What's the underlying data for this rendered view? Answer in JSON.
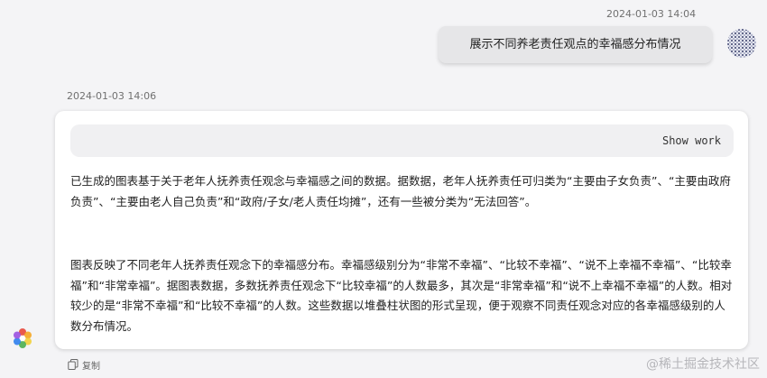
{
  "user_message": {
    "timestamp": "2024-01-03 14:04",
    "text": "展示不同养老责任观点的幸福感分布情况"
  },
  "assistant_message": {
    "timestamp": "2024-01-03 14:06",
    "show_work_label": "Show work",
    "paragraphs": [
      "已生成的图表基于关于老年人抚养责任观念与幸福感之间的数据。据数据，老年人抚养责任可归类为“主要由子女负责”、“主要由政府负责”、“主要由老人自己负责”和“政府/子女/老人责任均摊”，还有一些被分类为“无法回答”。",
      "图表反映了不同老年人抚养责任观念下的幸福感分布。幸福感级别分为“非常不幸福”、“比较不幸福”、“说不上幸福不幸福”、“比较幸福”和“非常幸福”。据图表数据，多数抚养责任观念下“比较幸福”的人数最多，其次是“非常幸福”和“说不上幸福不幸福”的人数。相对较少的是“非常不幸福”和“比较不幸福”的人数。这些数据以堆叠柱状图的形式呈现，便于观察不同责任观念对应的各幸福感级别的人数分布情况。"
    ],
    "copy_label": "复制"
  },
  "watermark": "@稀土掘金技术社区",
  "icons": {
    "avatar": "user-avatar",
    "bot_logo": "bot-logo-icon",
    "copy": "copy-icon"
  },
  "colors": {
    "background": "#f4f4f6",
    "user_bubble": "#e6e6e8",
    "card": "#ffffff",
    "work_bar": "#f0f0f2"
  }
}
